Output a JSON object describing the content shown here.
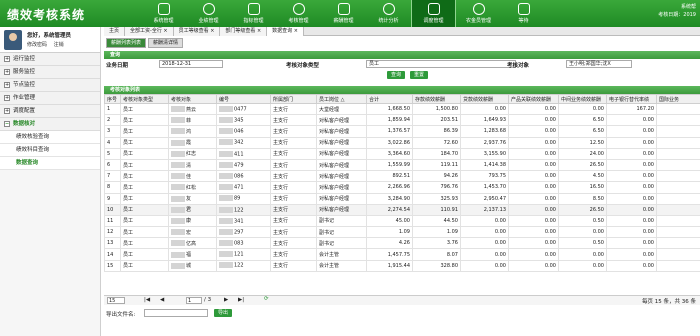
{
  "app": {
    "title": "绩效考核系统"
  },
  "topnav": [
    {
      "label": "系统管理"
    },
    {
      "label": "业绩管理"
    },
    {
      "label": "指标管理"
    },
    {
      "label": "考核管理"
    },
    {
      "label": "薪酬管理"
    },
    {
      "label": "统计分析"
    },
    {
      "label": "调度管理"
    },
    {
      "label": "农金员管理"
    },
    {
      "label": "等待"
    }
  ],
  "topright": {
    "line1": "系统帮",
    "line2": "考核日期：2019"
  },
  "user": {
    "name": "您好，系统管理员",
    "change_pwd": "修改密码",
    "logout": "注销"
  },
  "menu": [
    {
      "label": "运行监控"
    },
    {
      "label": "服务监控"
    },
    {
      "label": "节点监控"
    },
    {
      "label": "作业管理"
    },
    {
      "label": "调度配置"
    },
    {
      "label": "数据核对"
    }
  ],
  "submenu": [
    {
      "label": "绩效核验查询"
    },
    {
      "label": "绩效科目查询"
    },
    {
      "label": "数据查询"
    }
  ],
  "tabs": [
    {
      "label": "主页"
    },
    {
      "label": "全部工资-全行 ×"
    },
    {
      "label": "员工等级查看 ×"
    },
    {
      "label": "部门等级查看 ×"
    },
    {
      "label": "数据查询 ×"
    }
  ],
  "subtabs": [
    {
      "label": "薪酬列表列表"
    },
    {
      "label": "薪酬清详情"
    }
  ],
  "query": {
    "header": "查询",
    "date_label": "业务日期",
    "date_value": "2018-12-31",
    "type_label": "考核对象类型",
    "type_value": "员工",
    "obj_label": "考核对象",
    "obj_value": "王小明;郑国华;沈X",
    "search_btn": "查询",
    "reset_btn": "重置"
  },
  "list": {
    "header": "考核对象列表",
    "columns": [
      "序号",
      "考核对象类型",
      "考核对象",
      "编号",
      "所属部门",
      "员工岗位 △",
      "合计",
      "存款绩效薪酬",
      "贷款绩效薪酬",
      "产品关联绩效薪酬",
      "中间业务绩效薪酬",
      "电子银行替代率绩",
      "国际业务"
    ],
    "rows": [
      [
        "1",
        "员工",
        "燕云",
        "0477",
        "主支行",
        "大堂经理",
        "1,668.50",
        "1,500.80",
        "0.00",
        "0.00",
        "0.00",
        "167.20",
        ""
      ],
      [
        "2",
        "员工",
        "菲",
        "345",
        "主支行",
        "对私客户经理",
        "1,859.94",
        "203.51",
        "1,649.93",
        "0.00",
        "6.50",
        "0.00",
        ""
      ],
      [
        "3",
        "员工",
        "鸿",
        "046",
        "主支行",
        "对私客户经理",
        "1,376.57",
        "86.39",
        "1,283.68",
        "0.00",
        "6.50",
        "0.00",
        ""
      ],
      [
        "4",
        "员工",
        "霞",
        "342",
        "主支行",
        "对私客户经理",
        "3,022.86",
        "72.60",
        "2,937.76",
        "0.00",
        "12.50",
        "0.00",
        ""
      ],
      [
        "5",
        "员工",
        "红志",
        "411",
        "主支行",
        "对私客户经理",
        "3,364.60",
        "184.70",
        "3,155.90",
        "0.00",
        "24.00",
        "0.00",
        ""
      ],
      [
        "6",
        "员工",
        "清",
        "479",
        "主支行",
        "对私客户经理",
        "1,559.99",
        "119.11",
        "1,414.38",
        "0.00",
        "26.50",
        "0.00",
        ""
      ],
      [
        "7",
        "员工",
        "佳",
        "086",
        "主支行",
        "对私客户经理",
        "892.51",
        "94.26",
        "793.75",
        "0.00",
        "4.50",
        "0.00",
        ""
      ],
      [
        "8",
        "员工",
        "红松",
        "471",
        "主支行",
        "对私客户经理",
        "2,266.96",
        "796.76",
        "1,453.70",
        "0.00",
        "16.50",
        "0.00",
        ""
      ],
      [
        "9",
        "员工",
        "友",
        "89",
        "主支行",
        "对私客户经理",
        "3,284.90",
        "325.93",
        "2,950.47",
        "0.00",
        "8.50",
        "0.00",
        ""
      ],
      [
        "10",
        "员工",
        "君",
        "122",
        "主支行",
        "对私客户经理",
        "2,274.54",
        "110.91",
        "2,137.13",
        "0.00",
        "26.50",
        "0.00",
        ""
      ],
      [
        "11",
        "员工",
        "康",
        "341",
        "主支行",
        "副书记",
        "45.00",
        "44.50",
        "0.00",
        "0.00",
        "0.50",
        "0.00",
        ""
      ],
      [
        "12",
        "员工",
        "宏",
        "297",
        "主支行",
        "副书记",
        "1.09",
        "1.09",
        "0.00",
        "0.00",
        "0.00",
        "0.00",
        ""
      ],
      [
        "13",
        "员工",
        "亿高",
        "083",
        "主支行",
        "副书记",
        "4.26",
        "3.76",
        "0.00",
        "0.00",
        "0.50",
        "0.00",
        ""
      ],
      [
        "14",
        "员工",
        "福",
        "121",
        "主支行",
        "会计主管",
        "1,457.75",
        "8.07",
        "0.00",
        "0.00",
        "0.00",
        "0.00",
        ""
      ],
      [
        "15",
        "员工",
        "城",
        "122",
        "主支行",
        "会计主管",
        "1,915.44",
        "328.80",
        "0.00",
        "0.00",
        "0.00",
        "0.00",
        ""
      ]
    ]
  },
  "pager": {
    "page_size": "15",
    "page": "1",
    "total_pages": "/ 3",
    "summary": "每页 15 条，共 36 条"
  },
  "export": {
    "label": "导出文件名:",
    "button": "导出"
  },
  "colors": {
    "primary": "#2e9a3a"
  }
}
